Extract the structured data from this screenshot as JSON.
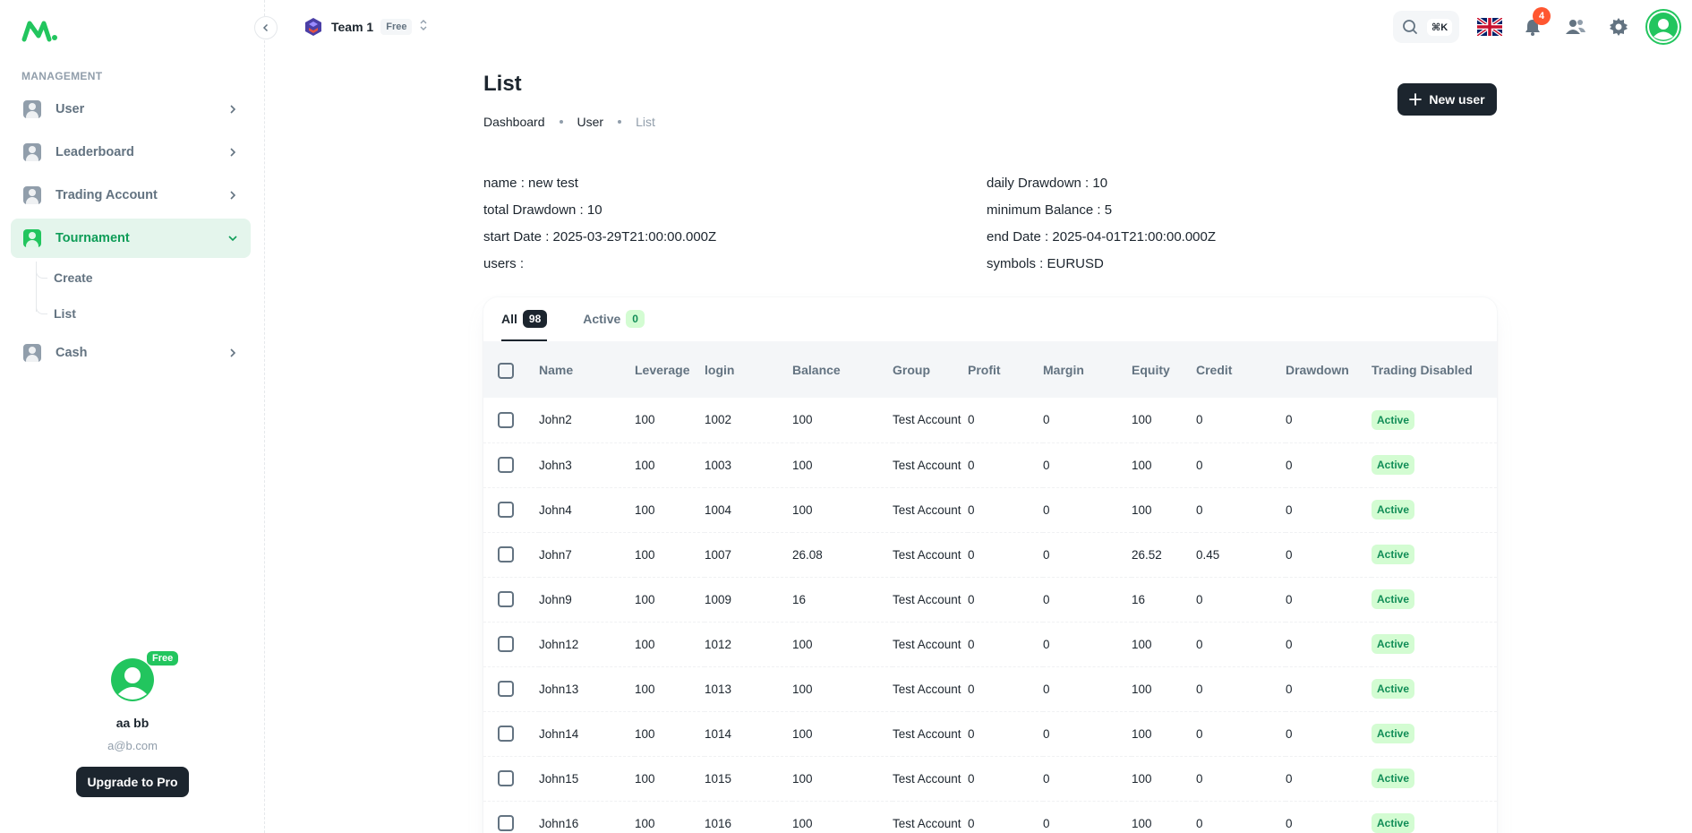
{
  "sidebar": {
    "section_label": "MANAGEMENT",
    "items": [
      {
        "label": "User",
        "icon": "user-icon",
        "expanded": false
      },
      {
        "label": "Leaderboard",
        "icon": "user-icon",
        "expanded": false
      },
      {
        "label": "Trading Account",
        "icon": "user-icon",
        "expanded": false
      },
      {
        "label": "Tournament",
        "icon": "user-icon",
        "expanded": true,
        "active": true,
        "children": [
          {
            "label": "Create"
          },
          {
            "label": "List"
          }
        ]
      },
      {
        "label": "Cash",
        "icon": "user-icon",
        "expanded": false
      }
    ],
    "user": {
      "name": "aa bb",
      "email": "a@b.com",
      "badge": "Free"
    },
    "upgrade_label": "Upgrade to Pro"
  },
  "header": {
    "team_name": "Team 1",
    "team_plan": "Free",
    "shortcut": "⌘K",
    "notification_count": "4",
    "language_icon": "uk-flag-icon"
  },
  "page": {
    "title": "List",
    "breadcrumb": [
      "Dashboard",
      "User",
      "List"
    ],
    "new_user_label": "New user"
  },
  "tournament_info": {
    "left": [
      "name : new test",
      "total Drawdown : 10",
      "start Date : 2025-03-29T21:00:00.000Z",
      "users :"
    ],
    "right": [
      "daily Drawdown : 10",
      "minimum Balance : 5",
      "end Date : 2025-04-01T21:00:00.000Z",
      "symbols : EURUSD"
    ]
  },
  "tabs": [
    {
      "label": "All",
      "count": "98",
      "active": true
    },
    {
      "label": "Active",
      "count": "0",
      "active": false
    }
  ],
  "table": {
    "columns": [
      "Name",
      "Leverage",
      "login",
      "Balance",
      "Group",
      "Profit",
      "Margin",
      "Equity",
      "Credit",
      "Drawdown",
      "Trading Disabled"
    ],
    "rows": [
      [
        "John2",
        "100",
        "1002",
        "100",
        "Test Account",
        "0",
        "0",
        "100",
        "0",
        "0",
        "Active"
      ],
      [
        "John3",
        "100",
        "1003",
        "100",
        "Test Account",
        "0",
        "0",
        "100",
        "0",
        "0",
        "Active"
      ],
      [
        "John4",
        "100",
        "1004",
        "100",
        "Test Account",
        "0",
        "0",
        "100",
        "0",
        "0",
        "Active"
      ],
      [
        "John7",
        "100",
        "1007",
        "26.08",
        "Test Account",
        "0",
        "0",
        "26.52",
        "0.45",
        "0",
        "Active"
      ],
      [
        "John9",
        "100",
        "1009",
        "16",
        "Test Account",
        "0",
        "0",
        "16",
        "0",
        "0",
        "Active"
      ],
      [
        "John12",
        "100",
        "1012",
        "100",
        "Test Account",
        "0",
        "0",
        "100",
        "0",
        "0",
        "Active"
      ],
      [
        "John13",
        "100",
        "1013",
        "100",
        "Test Account",
        "0",
        "0",
        "100",
        "0",
        "0",
        "Active"
      ],
      [
        "John14",
        "100",
        "1014",
        "100",
        "Test Account",
        "0",
        "0",
        "100",
        "0",
        "0",
        "Active"
      ],
      [
        "John15",
        "100",
        "1015",
        "100",
        "Test Account",
        "0",
        "0",
        "100",
        "0",
        "0",
        "Active"
      ],
      [
        "John16",
        "100",
        "1016",
        "100",
        "Test Account",
        "0",
        "0",
        "100",
        "0",
        "0",
        "Active"
      ]
    ]
  },
  "colors": {
    "accent": "#22C55E",
    "active_bg": "#E4F5EC",
    "dark": "#1C252E",
    "badge_red": "#FF5630"
  }
}
